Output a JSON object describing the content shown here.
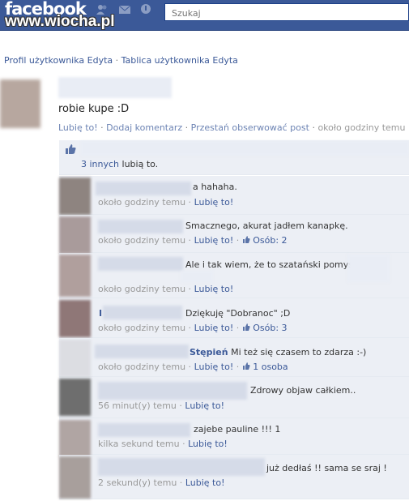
{
  "header": {
    "logo": "facebook",
    "watermark": "www.wiocha.pl",
    "search_placeholder": "Szukaj"
  },
  "breadcrumb": {
    "profile": "Profil użytkownika Edyta",
    "separator": "·",
    "wall": "Tablica użytkownika Edyta"
  },
  "post": {
    "text": "robie kupe :D",
    "actions": {
      "like": "Lubię to!",
      "comment": "Dodaj komentarz",
      "unfollow": "Przestań obserwować post",
      "time": "około godziny temu"
    }
  },
  "likes": {
    "others_link": "3 innych",
    "suffix": "lubią to."
  },
  "comments": [
    {
      "name": "",
      "text": "a hahaha.",
      "time": "około godziny temu",
      "like": "Lubię to!",
      "likes": ""
    },
    {
      "name": "",
      "text": "Smacznego, akurat jadłem kanapkę.",
      "time": "około godziny temu",
      "like": "Lubię to!",
      "likes": "Osób: 2"
    },
    {
      "name": "",
      "text": "Ale i tak wiem, że to szatański pomysł",
      "time": "około godziny temu",
      "like": "Lubię to!",
      "likes": ""
    },
    {
      "name": "I",
      "text": "Dziękuję \"Dobranoc\" ;D",
      "time": "około godziny temu",
      "like": "Lubię to!",
      "likes": "Osób: 3"
    },
    {
      "name": "Stępień",
      "text": "Mi też się czasem to zdarza :-)",
      "time": "około godziny temu",
      "like": "Lubię to!",
      "likes": "1 osoba"
    },
    {
      "name": "",
      "text": "Zdrowy objaw całkiem..",
      "time": "56 minut(y) temu",
      "like": "Lubię to!",
      "likes": ""
    },
    {
      "name": "",
      "text": "zajebe pauline !!! 1",
      "time": "kilka sekund temu",
      "like": "Lubię to!",
      "likes": ""
    },
    {
      "name": "",
      "text": "już dedłaś !! sama se sraj !",
      "time": "2 sekund(y) temu",
      "like": "Lubię to!",
      "likes": ""
    }
  ],
  "colors": {
    "brand_blue": "#3b5998",
    "link_blue": "#3b5998",
    "comment_bg": "#eceff5",
    "meta_gray": "#999999"
  }
}
